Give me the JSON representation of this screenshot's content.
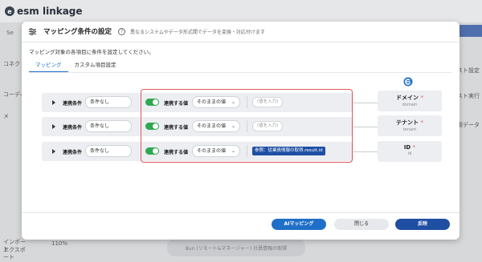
{
  "background": {
    "logo": "esm linkage",
    "left_items": [
      "コネク",
      "コーディ",
      "メ",
      "インポート",
      "エクスポート"
    ],
    "right_items": [
      "スト設定",
      "スト実行",
      "用データ"
    ],
    "back_label": "Se",
    "zoom": "110%",
    "bottom_card": "8un (リモート&マネージャー) 社員情報の取得"
  },
  "dialog": {
    "title": "マッピング条件の設定",
    "subtitle": "異なるシステムやデータ形式間でデータを変換・対応付けます",
    "description": "マッピング対象の各項目に条件を設定してください。",
    "tabs": [
      {
        "label": "マッピング",
        "active": true
      },
      {
        "label": "カスタム項目設定",
        "active": false
      }
    ],
    "rows": [
      {
        "condition_label": "連携条件",
        "condition_value": "条件なし",
        "link_label": "連携する値",
        "value_mode": "そのままの値",
        "input_placeholder": "(値を入力)",
        "chip": ""
      },
      {
        "condition_label": "連携条件",
        "condition_value": "条件なし",
        "link_label": "連携する値",
        "value_mode": "そのままの値",
        "input_placeholder": "(値を入力)",
        "chip": ""
      },
      {
        "condition_label": "連携条件",
        "condition_value": "条件なし",
        "link_label": "連携する値",
        "value_mode": "そのままの値",
        "input_placeholder": "",
        "chip": "参照：従業員情報の取得.result.id"
      }
    ],
    "targets": [
      {
        "name": "ドメイン",
        "required": "*",
        "key": "domain"
      },
      {
        "name": "テナント",
        "required": "*",
        "key": "tenant"
      },
      {
        "name": "ID",
        "required": "*",
        "key": "id"
      }
    ],
    "buttons": {
      "ai": "AIマッピング",
      "close": "閉じる",
      "apply": "反映"
    }
  },
  "colors": {
    "accent": "#1f6fc8",
    "primary_dark": "#1f4fa3",
    "toggle_on": "#2fa84f",
    "highlight": "#e05a5a"
  }
}
